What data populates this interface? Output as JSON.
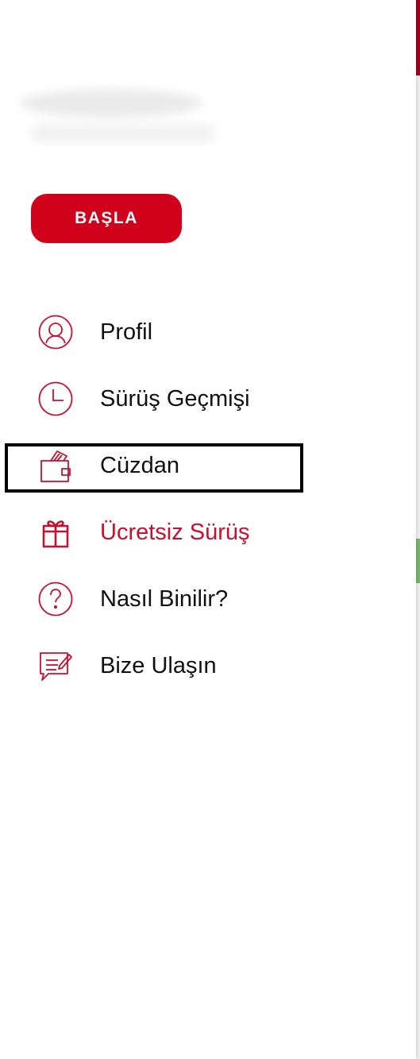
{
  "drawer": {
    "start_button_label": "BAŞLA",
    "items": [
      {
        "label": "Profil",
        "icon": "profile-icon"
      },
      {
        "label": "Sürüş Geçmişi",
        "icon": "clock-icon"
      },
      {
        "label": "Cüzdan",
        "icon": "wallet-icon"
      },
      {
        "label": "Ücretsiz Sürüş",
        "icon": "gift-icon"
      },
      {
        "label": "Nasıl Binilir?",
        "icon": "question-icon"
      },
      {
        "label": "Bize Ulaşın",
        "icon": "message-icon"
      }
    ]
  },
  "colors": {
    "accent": "#d0021b",
    "icon": "#c8102e",
    "text": "#111111"
  }
}
